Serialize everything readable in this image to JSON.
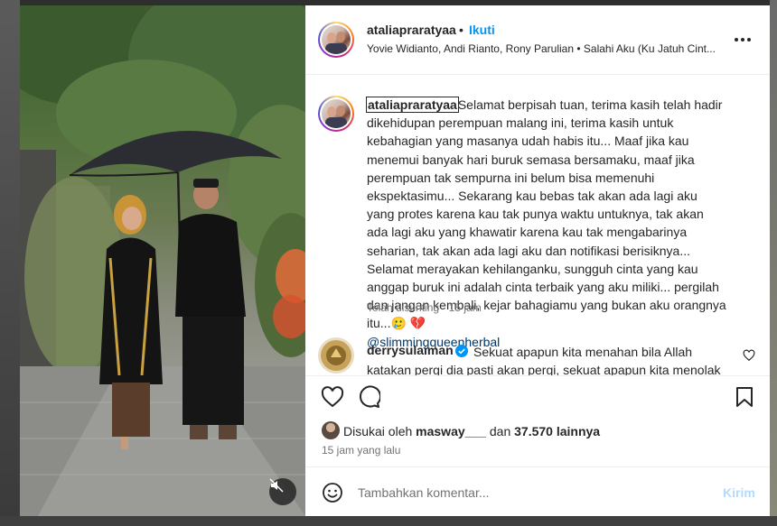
{
  "post": {
    "username": "ataliapraratyaa",
    "follow_label": "Ikuti",
    "dot": "•",
    "audio": "Yovie Widianto, Andi Rianto, Rony Parulian • Salahi Aku (Ku Jatuh Cint...",
    "caption": {
      "text": "Selamat berpisah tuan, terima kasih telah hadir dikehidupan perempuan malang ini, terima kasih untuk kebahagian yang masanya udah habis itu... Maaf jika kau menemui banyak hari buruk semasa bersamaku, maaf jika perempuan tak sempurna ini belum bisa memenuhi ekspektasimu... Sekarang kau bebas tak akan ada lagi aku yang protes karena kau tak punya waktu untuknya, tak akan ada lagi aku yang khawatir karena kau tak mengabarinya seharian, tak akan ada lagi aku dan notifikasi berisiknya... Selamat merayakan kehilanganku, sungguh cinta yang kau anggap buruk ini adalah cinta terbaik yang aku miliki... pergilah dan jangan kembali, kejar bahagiamu yang bukan aku orangnya itu...🥲 💔",
      "mention": "@slimmingqueenherbal",
      "meta": "Telah disunting · 15 jam"
    },
    "comment": {
      "username": "derrysulaiman",
      "text": "Sekuat apapun kita menahan bila Allah katakan pergi dia pasti akan pergi, sekuat apapun kita menolak"
    },
    "likes": {
      "prefix": "Disukai oleh",
      "user": "masway___",
      "joiner": "dan",
      "count": "37.570 lainnya"
    },
    "time_ago": "15 jam yang lalu",
    "add_comment": {
      "placeholder": "Tambahkan komentar...",
      "post_label": "Kirim"
    }
  },
  "colors": {
    "link": "#0095f6",
    "mention": "#00376b",
    "muted": "#737373",
    "verified": "#0095f6",
    "post_disabled": "#b3dbff"
  },
  "icons": [
    "more-icon",
    "heart-icon",
    "comment-icon",
    "bookmark-icon",
    "emoji-icon",
    "verified-icon",
    "mute-icon"
  ]
}
